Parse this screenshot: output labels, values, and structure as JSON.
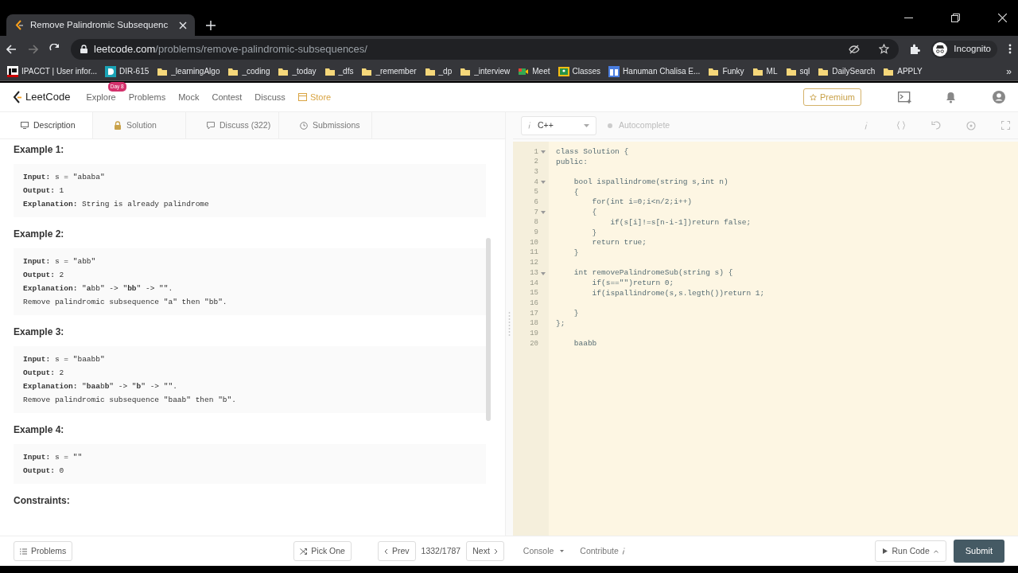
{
  "browser": {
    "tab": {
      "title": "Remove Palindromic Subsequenc"
    },
    "url": {
      "host": "leetcode.com",
      "path": "/problems/remove-palindromic-subsequences/"
    },
    "profile": "Incognito",
    "bookmarks": [
      {
        "label": "IPACCT | User infor...",
        "kind": "ip"
      },
      {
        "label": "DIR-615",
        "kind": "d"
      },
      {
        "label": "_learningAlgo",
        "kind": "folder"
      },
      {
        "label": "_coding",
        "kind": "folder"
      },
      {
        "label": "_today",
        "kind": "folder"
      },
      {
        "label": "_dfs",
        "kind": "folder"
      },
      {
        "label": "_remember",
        "kind": "folder"
      },
      {
        "label": "_dp",
        "kind": "folder"
      },
      {
        "label": "_interview",
        "kind": "folder"
      },
      {
        "label": "Meet",
        "kind": "meet"
      },
      {
        "label": "Classes",
        "kind": "classroom"
      },
      {
        "label": "Hanuman Chalisa E...",
        "kind": "doc"
      },
      {
        "label": "Funky",
        "kind": "folder"
      },
      {
        "label": "ML",
        "kind": "folder"
      },
      {
        "label": "sql",
        "kind": "folder"
      },
      {
        "label": "DailySearch",
        "kind": "folder"
      },
      {
        "label": "APPLY",
        "kind": "folder"
      }
    ],
    "more": "»"
  },
  "nav": {
    "logo": "LeetCode",
    "items": [
      {
        "label": "Explore",
        "badge": "Day 8",
        "kind": "link"
      },
      {
        "label": "Problems",
        "kind": "link"
      },
      {
        "label": "Mock",
        "kind": "link"
      },
      {
        "label": "Contest",
        "kind": "link"
      },
      {
        "label": "Discuss",
        "kind": "link"
      },
      {
        "label": "Store",
        "kind": "store"
      }
    ],
    "premium": "Premium"
  },
  "pane_tabs": [
    {
      "label": "Description",
      "selected": true
    },
    {
      "label": "Solution",
      "selected": false
    },
    {
      "label": "Discuss (322)",
      "selected": false
    },
    {
      "label": "Submissions",
      "selected": false
    }
  ],
  "examples": [
    {
      "title": "Example 1:",
      "lines": [
        {
          "label": "Input:",
          "value": " s = \"ababa\""
        },
        {
          "label": "Output:",
          "value": " 1"
        },
        {
          "label": "Explanation:",
          "value": " String is already palindrome"
        }
      ]
    },
    {
      "title": "Example 2:",
      "lines": [
        {
          "label": "Input:",
          "value": " s = \"abb\""
        },
        {
          "label": "Output:",
          "value": " 2"
        },
        {
          "label": "Explanation:",
          "value": " \"**a**bb\" -> \"**bb**\" -> \"\"."
        },
        {
          "value": "Remove palindromic subsequence \"a\" then \"bb\"."
        }
      ]
    },
    {
      "title": "Example 3:",
      "lines": [
        {
          "label": "Input:",
          "value": " s = \"baabb\""
        },
        {
          "label": "Output:",
          "value": " 2"
        },
        {
          "label": "Explanation:",
          "value": " \"**baa**b**b**\" -> \"**b**\" -> \"\"."
        },
        {
          "value": "Remove palindromic subsequence \"baab\" then \"b\"."
        }
      ]
    },
    {
      "title": "Example 4:",
      "lines": [
        {
          "label": "Input:",
          "value": " s = \"\""
        },
        {
          "label": "Output:",
          "value": " 0"
        }
      ]
    }
  ],
  "constraints_heading": "Constraints:",
  "editor": {
    "language": "C++",
    "autocomplete": "Autocomplete",
    "lines": [
      {
        "number": "1",
        "text": "class Solution {",
        "foldable": true
      },
      {
        "number": "2",
        "text": "public:",
        "foldable": false
      },
      {
        "number": "3",
        "foldable": false
      },
      {
        "number": "4",
        "text": "    bool ispallindrome(string s,int n)",
        "foldable": true
      },
      {
        "number": "5",
        "text": "    {",
        "foldable": false
      },
      {
        "number": "6",
        "text": "        for(int i=0;i<n/2;i++)",
        "foldable": false
      },
      {
        "number": "7",
        "text": "        {",
        "foldable": true
      },
      {
        "number": "8",
        "text": "            if(s[i]!=s[n-i-1])return false;",
        "foldable": false
      },
      {
        "number": "9",
        "text": "        }",
        "foldable": false
      },
      {
        "number": "10",
        "text": "        return true;",
        "foldable": false
      },
      {
        "number": "11",
        "text": "    }",
        "foldable": false
      },
      {
        "number": "12",
        "foldable": false
      },
      {
        "number": "13",
        "text": "    int removePalindromeSub(string s) {",
        "foldable": true
      },
      {
        "number": "14",
        "text": "        if(s==\"\")return 0;",
        "foldable": false
      },
      {
        "number": "15",
        "text": "        if(ispallindrome(s,s.legth())return 1;",
        "foldable": false
      },
      {
        "number": "16",
        "foldable": false
      },
      {
        "number": "17",
        "text": "    }",
        "foldable": false
      },
      {
        "number": "18",
        "text": "};",
        "foldable": false
      },
      {
        "number": "19",
        "foldable": false
      },
      {
        "number": "20",
        "text": "    baabb",
        "foldable": false
      }
    ]
  },
  "footer": {
    "problems": "Problems",
    "pick_one": "Pick One",
    "prev": "Prev",
    "counter": "1332/1787",
    "next": "Next",
    "console": "Console",
    "contribute": "Contribute",
    "run_code": "Run Code",
    "submit": "Submit"
  }
}
